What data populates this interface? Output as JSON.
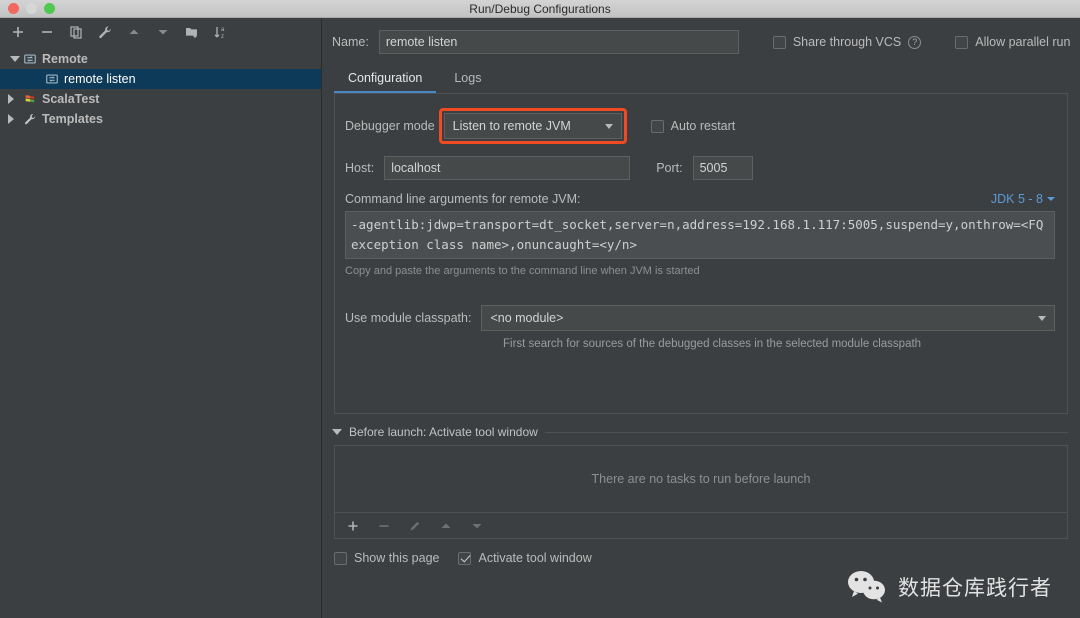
{
  "window": {
    "title": "Run/Debug Configurations",
    "controls": [
      "close-button",
      "minimize-button",
      "maximize-button"
    ]
  },
  "sidebar": {
    "toolbar": [
      {
        "name": "add-icon",
        "glyph": "+"
      },
      {
        "name": "remove-icon",
        "glyph": "−"
      },
      {
        "name": "copy-icon",
        "glyph": "⧉"
      },
      {
        "name": "edit-templates-wrench-icon",
        "glyph": "🔧"
      },
      {
        "name": "move-up-icon",
        "glyph": "▲"
      },
      {
        "name": "move-down-icon",
        "glyph": "▼"
      },
      {
        "name": "new-folder-icon",
        "glyph": "📁"
      },
      {
        "name": "sort-alphabetically-icon",
        "glyph": "↓"
      }
    ],
    "tree": [
      {
        "label": "Remote",
        "level": 0,
        "expanded": true,
        "selected": false,
        "icon": "remote-config-icon"
      },
      {
        "label": "remote listen",
        "level": 1,
        "expanded": null,
        "selected": true,
        "icon": "remote-config-icon"
      },
      {
        "label": "ScalaTest",
        "level": 0,
        "expanded": false,
        "selected": false,
        "icon": "scala-icon"
      },
      {
        "label": "Templates",
        "level": 0,
        "expanded": false,
        "selected": false,
        "icon": "wrench-icon"
      }
    ]
  },
  "header": {
    "name_label": "Name:",
    "name_value": "remote listen",
    "name_placeholder": "Name",
    "share_through_vcs_label": "Share through VCS",
    "share_through_vcs_checked": false,
    "help_glyph": "?",
    "allow_parallel_run_label": "Allow parallel run",
    "allow_parallel_run_checked": false
  },
  "tabs": [
    {
      "label": "Configuration",
      "active": true
    },
    {
      "label": "Logs",
      "active": false
    }
  ],
  "configuration": {
    "debugger_mode_label": "Debugger mode",
    "debugger_mode_value": "Listen to remote JVM",
    "debugger_mode_highlighted": true,
    "highlight_color": "#f04a22",
    "auto_restart_label": "Auto restart",
    "auto_restart_checked": false,
    "host_label": "Host:",
    "host_value": "localhost",
    "port_label": "Port:",
    "port_value": "5005",
    "args_label": "Command line arguments for remote JVM:",
    "jdk_link": "JDK 5 - 8",
    "args_value": "-agentlib:jdwp=transport=dt_socket,server=n,address=192.168.1.117:5005,suspend=y,onthrow=<FQ exception class name>,onuncaught=<y/n>",
    "args_hint": "Copy and paste the arguments to the command line when JVM is started",
    "classpath_label": "Use module classpath:",
    "classpath_value": "<no module>",
    "classpath_hint": "First search for sources of the debugged classes in the selected module classpath"
  },
  "before_launch": {
    "header": "Before launch: Activate tool window",
    "expanded": true,
    "empty_text": "There are no tasks to run before launch",
    "toolbar": [
      {
        "name": "add-task-icon",
        "glyph": "+",
        "enabled": true
      },
      {
        "name": "remove-task-icon",
        "glyph": "−",
        "enabled": false
      },
      {
        "name": "edit-task-pencil-icon",
        "glyph": "✎",
        "enabled": false
      },
      {
        "name": "task-move-up-icon",
        "glyph": "▲",
        "enabled": false
      },
      {
        "name": "task-move-down-icon",
        "glyph": "▼",
        "enabled": false
      }
    ],
    "show_this_page_label": "Show this page",
    "show_this_page_checked": false,
    "activate_tool_window_label": "Activate tool window",
    "activate_tool_window_checked": true
  },
  "watermark": {
    "text": "数据仓库践行者",
    "icon": "wechat-icon"
  },
  "colors": {
    "background": "#3c3f41",
    "field": "#45494a",
    "selection": "#0d3a58",
    "accent_blue": "#4a88c7",
    "link_blue": "#5b9bd5",
    "highlight_red": "#f04a22"
  }
}
